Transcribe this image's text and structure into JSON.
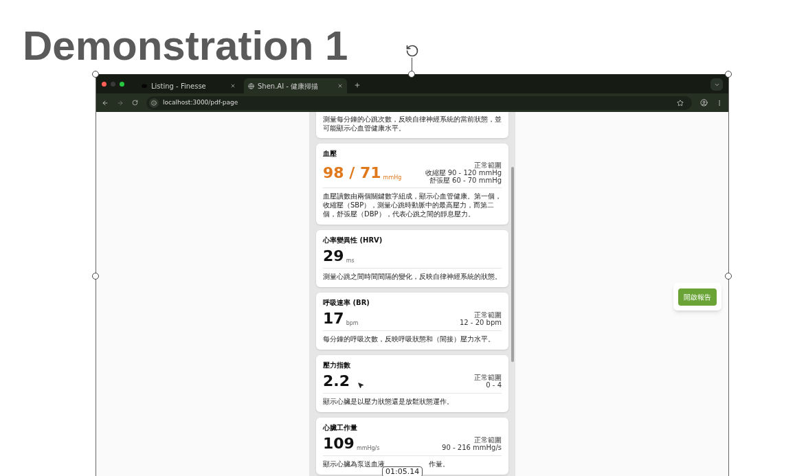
{
  "slide": {
    "title": "Demonstration 1"
  },
  "browser": {
    "tabs": [
      {
        "title": "Listing - Finesse",
        "selected": false
      },
      {
        "title": "Shen.AI - 健康掃描",
        "selected": true
      }
    ],
    "url": "localhost:3000/pdf-page"
  },
  "cards": [
    {
      "kind": "partial",
      "description": "測量每分鐘的心跳次數，反映自律神經系統的當前狀態，並可能顯示心血管健康水平。"
    },
    {
      "kind": "metric",
      "title": "血壓",
      "value": "98 / 71",
      "unit": "mmHg",
      "highlight": true,
      "range_label": "正常範圍",
      "range_lines": [
        "收縮壓 90 - 120 mmHg",
        "舒張壓 60 - 70 mmHg"
      ],
      "description": "血壓讀數由兩個關鍵數字組成，顯示心血管健康。第一個，收縮壓（SBP），測量心跳時動脈中的最高壓力，而第二個，舒張壓（DBP），代表心跳之間的靜息壓力。"
    },
    {
      "kind": "metric",
      "title": "心率變異性 (HRV)",
      "value": "29",
      "unit": "ms",
      "highlight": false,
      "description": "測量心跳之間時間間隔的變化，反映自律神經系統的狀態。"
    },
    {
      "kind": "metric",
      "title": "呼吸速率 (BR)",
      "value": "17",
      "unit": "bpm",
      "highlight": false,
      "range_label": "正常範圍",
      "range_lines": [
        "12 - 20 bpm"
      ],
      "description": "每分鐘的呼吸次數，反映呼吸狀態和（間接）壓力水平。"
    },
    {
      "kind": "metric",
      "title": "壓力指數",
      "value": "2.2",
      "highlight": false,
      "range_label": "正常範圍",
      "range_lines": [
        "0 - 4"
      ],
      "description": "顯示心臟是以壓力狀態還是放鬆狀態運作。"
    },
    {
      "kind": "metric",
      "title": "心臟工作量",
      "value": "109",
      "unit": "mmHg/s",
      "highlight": false,
      "range_label": "正常範圍",
      "range_lines": [
        "90 - 216 mmHg/s"
      ],
      "description_parts": [
        "顯示心臟為泵送血液",
        "作量。"
      ]
    }
  ],
  "open_report_button": "開啟報告",
  "timestamp": "01:05.14"
}
